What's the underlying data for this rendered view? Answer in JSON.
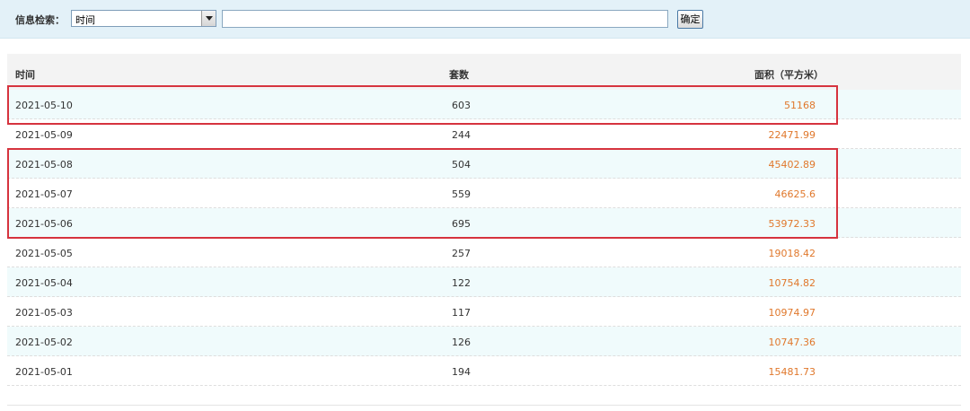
{
  "search": {
    "label": "信息检索：",
    "select_value": "时间",
    "input_value": "",
    "confirm_label": "确定"
  },
  "table": {
    "columns": [
      "时间",
      "套数",
      "面积（平方米）"
    ],
    "rows": [
      {
        "date": "2021-05-10",
        "count": "603",
        "area": "51168"
      },
      {
        "date": "2021-05-09",
        "count": "244",
        "area": "22471.99"
      },
      {
        "date": "2021-05-08",
        "count": "504",
        "area": "45402.89"
      },
      {
        "date": "2021-05-07",
        "count": "559",
        "area": "46625.6"
      },
      {
        "date": "2021-05-06",
        "count": "695",
        "area": "53972.33"
      },
      {
        "date": "2021-05-05",
        "count": "257",
        "area": "19018.42"
      },
      {
        "date": "2021-05-04",
        "count": "122",
        "area": "10754.82"
      },
      {
        "date": "2021-05-03",
        "count": "117",
        "area": "10974.97"
      },
      {
        "date": "2021-05-02",
        "count": "126",
        "area": "10747.36"
      },
      {
        "date": "2021-05-01",
        "count": "194",
        "area": "15481.73"
      }
    ]
  },
  "colors": {
    "header_bg": "#e3f1f8",
    "row_alt_bg": "#f0fbfc",
    "area_text": "#e0782c",
    "highlight_border": "#d6333e"
  }
}
